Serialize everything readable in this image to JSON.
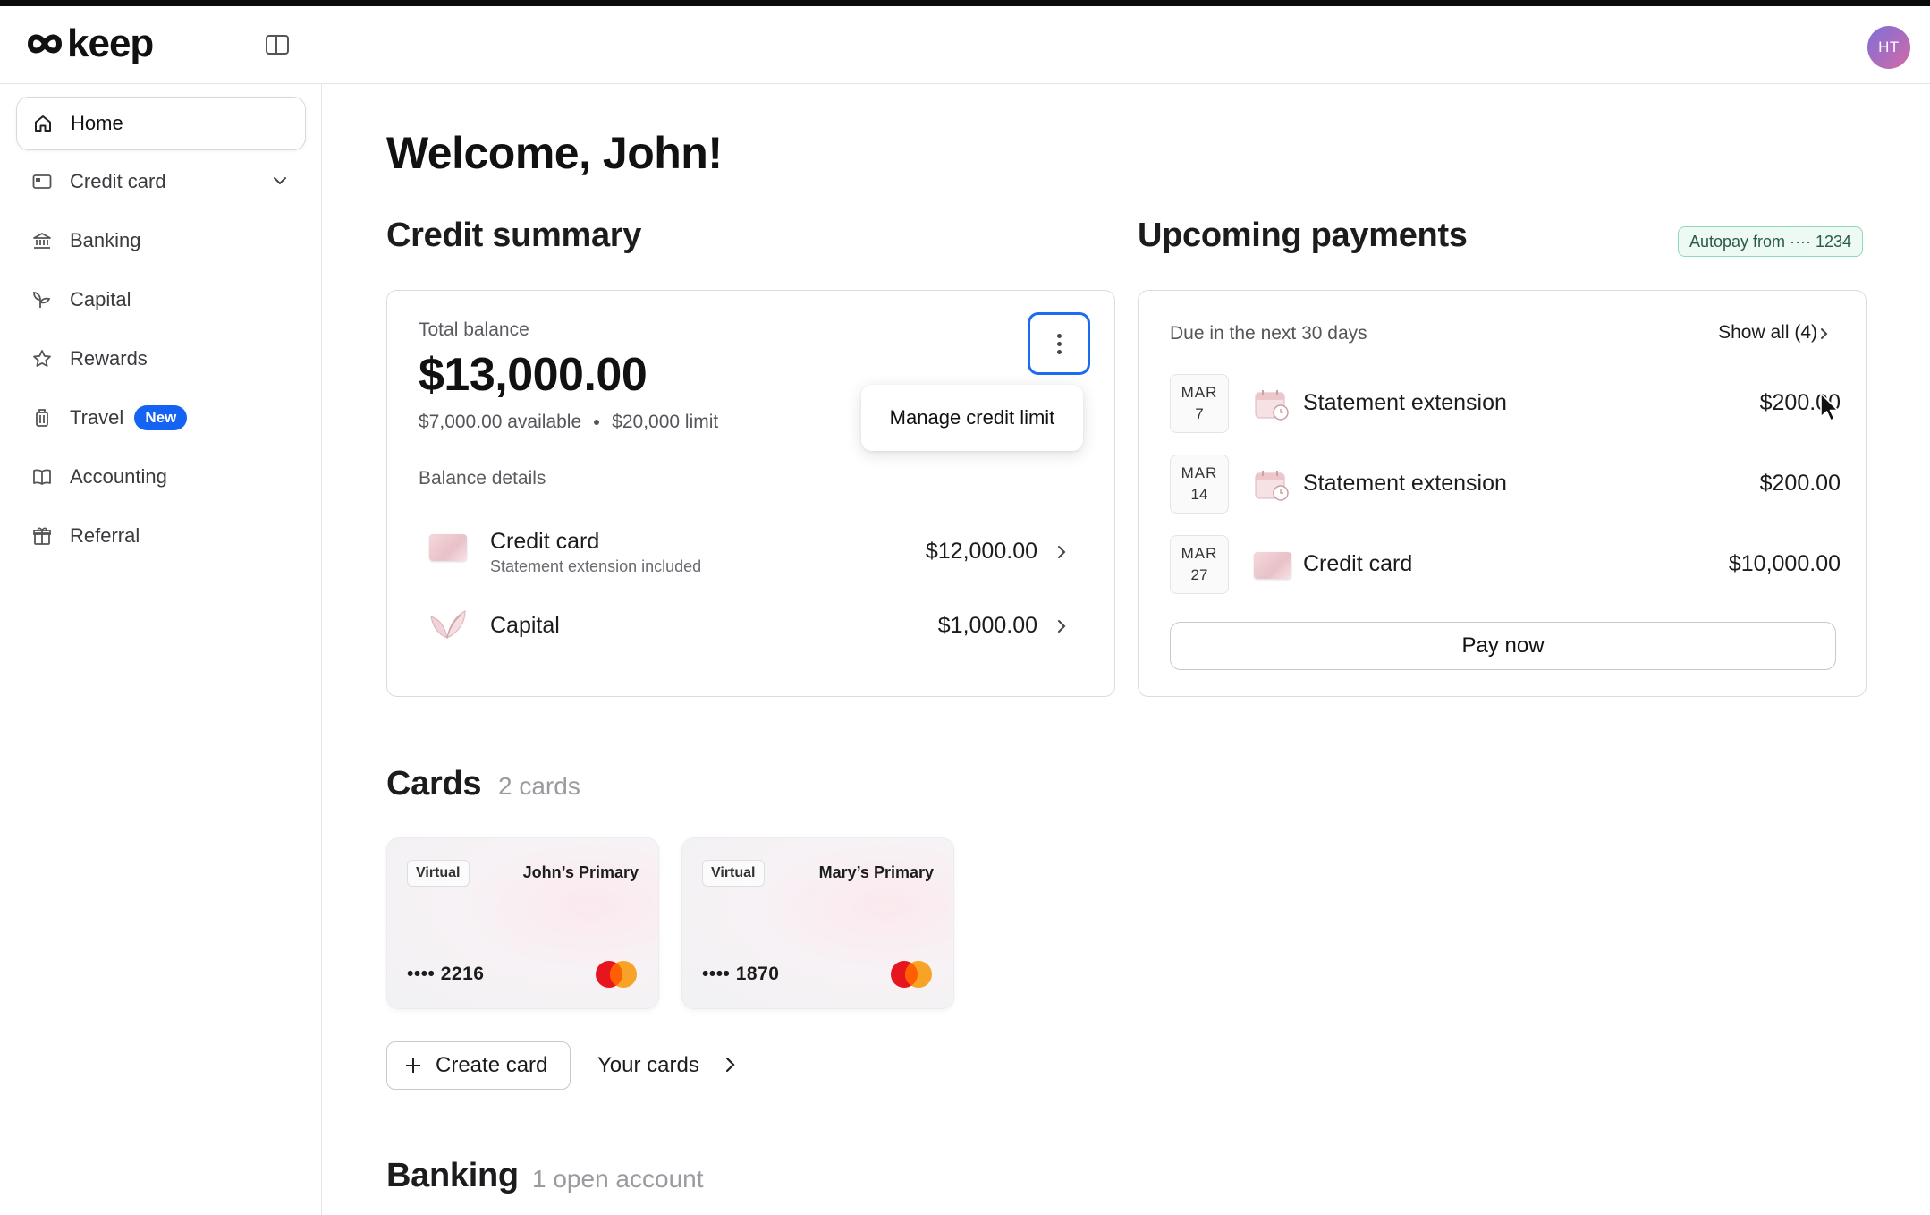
{
  "app": {
    "logo_text": "keep",
    "avatar_initials": "HT"
  },
  "sidebar": {
    "items": [
      {
        "label": "Home",
        "icon": "home-icon",
        "active": true
      },
      {
        "label": "Credit card",
        "icon": "credit-card-icon"
      },
      {
        "label": "Banking",
        "icon": "bank-icon"
      },
      {
        "label": "Capital",
        "icon": "sprout-icon"
      },
      {
        "label": "Rewards",
        "icon": "star-icon"
      },
      {
        "label": "Travel",
        "icon": "luggage-icon",
        "badge": "New"
      },
      {
        "label": "Accounting",
        "icon": "book-icon"
      },
      {
        "label": "Referral",
        "icon": "gift-icon"
      }
    ]
  },
  "main": {
    "welcome": "Welcome, John!",
    "credit_summary": {
      "title": "Credit summary",
      "total_balance_label": "Total balance",
      "total_balance": "$13,000.00",
      "available": "$7,000.00 available",
      "limit": "$20,000 limit",
      "menu_item": "Manage credit limit",
      "balance_details_label": "Balance details",
      "rows": [
        {
          "title": "Credit card",
          "subtitle": "Statement extension included",
          "amount": "$12,000.00"
        },
        {
          "title": "Capital",
          "subtitle": "",
          "amount": "$1,000.00"
        }
      ]
    },
    "upcoming_payments": {
      "title": "Upcoming payments",
      "autopay": "Autopay from ···· 1234",
      "due_label": "Due in the next 30 days",
      "show_all": "Show all (4)",
      "items": [
        {
          "month": "MAR",
          "day": "7",
          "title": "Statement extension",
          "amount": "$200.00",
          "icon": "calendar-clock-icon"
        },
        {
          "month": "MAR",
          "day": "14",
          "title": "Statement extension",
          "amount": "$200.00",
          "icon": "calendar-clock-icon"
        },
        {
          "month": "MAR",
          "day": "27",
          "title": "Credit card",
          "amount": "$10,000.00",
          "icon": "card-thumbnail-icon"
        }
      ],
      "pay_button": "Pay now"
    },
    "cards": {
      "title": "Cards",
      "count": "2 cards",
      "items": [
        {
          "tag": "Virtual",
          "name": "John’s Primary",
          "number": "•••• 2216"
        },
        {
          "tag": "Virtual",
          "name": "Mary’s Primary",
          "number": "•••• 1870"
        }
      ],
      "create_button": "Create card",
      "your_cards_link": "Your cards"
    },
    "banking": {
      "title": "Banking",
      "count": "1 open account"
    }
  },
  "colors": {
    "accent_blue": "#1463f3",
    "autopay_green_bg": "#ecfaf3",
    "focus_ring": "#1b6cf0"
  }
}
